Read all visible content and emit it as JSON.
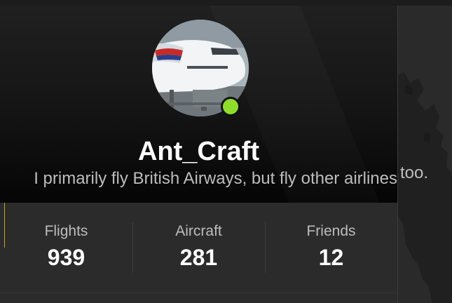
{
  "profile": {
    "username": "Ant_Craft",
    "bio": "I primarily fly British Airways, but fly other airlines too.",
    "bio_visible_tail": "too.",
    "status": "online",
    "status_color": "#8fdc2b",
    "avatar": "aircraft-avatar-icon"
  },
  "stats": [
    {
      "label": "Flights",
      "value": "939"
    },
    {
      "label": "Aircraft",
      "value": "281"
    },
    {
      "label": "Friends",
      "value": "12"
    }
  ]
}
